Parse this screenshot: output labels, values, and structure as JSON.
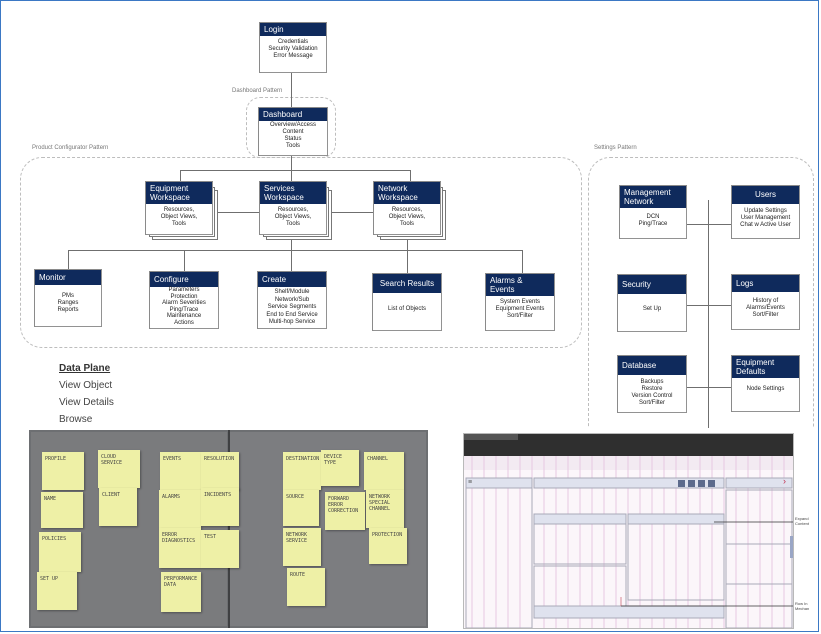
{
  "patterns": {
    "dashboard": "Dashboard  Pattern",
    "configurator": "Product  Configurator Pattern",
    "settings": "Settings Pattern"
  },
  "login": {
    "title": "Login",
    "body": "Credentials\nSecurity Validation\nError Message"
  },
  "dashboard": {
    "title": "Dashboard",
    "body": "Overview/Access\nContent\nStatus\nTools"
  },
  "workspaces": [
    {
      "title": "Equipment\nWorkspace",
      "body": "Resources,\nObject Views,\nTools"
    },
    {
      "title": "Services\nWorkspace",
      "body": "Resources,\nObject Views,\nTools"
    },
    {
      "title": "Network\nWorkspace",
      "body": "Resources,\nObject Views,\nTools"
    }
  ],
  "functions": [
    {
      "title": "Monitor",
      "body": "PMs\nRanges\nReports"
    },
    {
      "title": "Configure",
      "body": "Parameters\nProtection\nAlarm Severities\nPing/Trace\nMaintenance\nActions"
    },
    {
      "title": "Create",
      "body": "Shelf/Module\nNetwork/Sub\nService Segments\nEnd to End Service\nMulti-hop Service"
    },
    {
      "title": "Search Results",
      "body": "List of Objects"
    },
    {
      "title": "Alarms &\nEvents",
      "body": "System Events\nEquipment Events\nSort/Filter"
    }
  ],
  "settings": [
    {
      "title": "Management\nNetwork",
      "body": "DCN\nPing/Trace"
    },
    {
      "title": "Users",
      "body": "Update Settings\nUser Management\nChat w Active User"
    },
    {
      "title": "Security",
      "body": "Set Up"
    },
    {
      "title": "Logs",
      "body": "History of\nAlarms/Events\nSort/Filter"
    },
    {
      "title": "Database",
      "body": "Backups\nRestore\nVersion Control\nSort/Filter"
    },
    {
      "title": "Equipment\nDefaults",
      "body": "Node Settings"
    }
  ],
  "data_plane": {
    "heading": "Data Plane",
    "items": [
      "View Object",
      "View Details",
      "Browse"
    ]
  },
  "sticky_notes": [
    "PROFILE",
    "CLOUD\nSERVICE",
    "EVENTS",
    "RESOLUTION",
    "NAME",
    "CLIENT",
    "ALARMS",
    "INCIDENTS",
    "POLICIES",
    "ERROR\nDIAGNOSTICS",
    "TEST",
    "SET UP",
    "PERFORMANCE\nDATA",
    "DESTINATION",
    "DEVICE\nTYPE",
    "CHANNEL",
    "SOURCE",
    "FORWARD\nERROR\nCORRECTION",
    "NETWORK\nSPECIAL\nCHANNEL",
    "NETWORK\nSERVICE",
    "PROTECTION",
    "ROUTE"
  ],
  "wireframe": {
    "callouts": [
      "Expand\nContent",
      "Row In\nMechan"
    ],
    "arrow": "›"
  },
  "colors": {
    "header": "#0f2a5c",
    "note": "#eef0a6",
    "frame": "#3b78c4"
  }
}
